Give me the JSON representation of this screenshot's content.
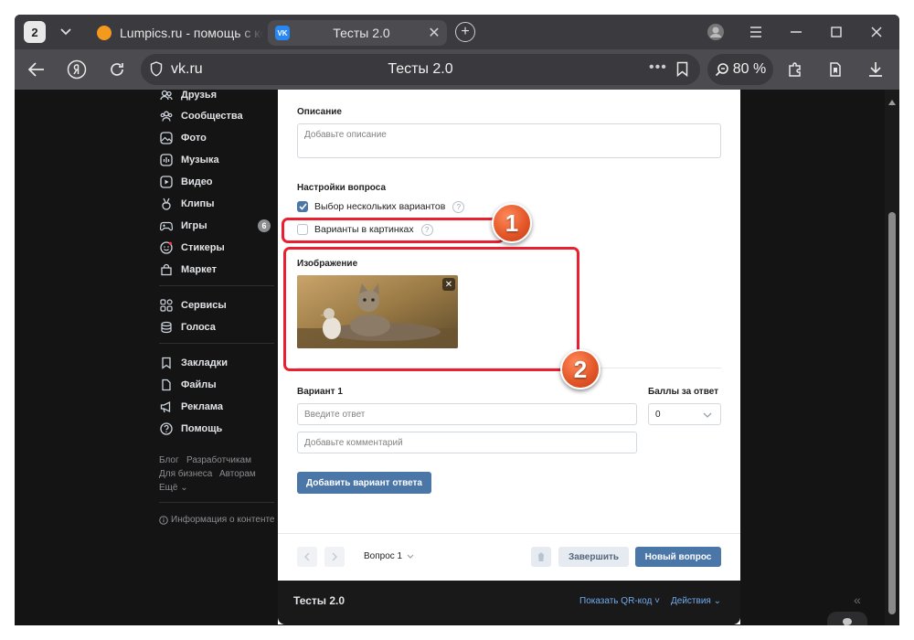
{
  "browser": {
    "tab_count": "2",
    "tabs": [
      {
        "title": "Lumpics.ru - помощь с компьютером",
        "active": false
      },
      {
        "title": "Тесты 2.0",
        "active": true
      }
    ],
    "address": {
      "domain": "vk.ru",
      "page_title": "Тесты 2.0"
    },
    "zoom": "80 %"
  },
  "sidebar": {
    "items": [
      {
        "label": "Друзья",
        "icon": "friends-icon"
      },
      {
        "label": "Сообщества",
        "icon": "communities-icon"
      },
      {
        "label": "Фото",
        "icon": "photo-icon"
      },
      {
        "label": "Музыка",
        "icon": "music-icon"
      },
      {
        "label": "Видео",
        "icon": "video-icon"
      },
      {
        "label": "Клипы",
        "icon": "clips-icon"
      },
      {
        "label": "Игры",
        "icon": "games-icon",
        "badge": "6"
      },
      {
        "label": "Стикеры",
        "icon": "stickers-icon"
      },
      {
        "label": "Маркет",
        "icon": "market-icon"
      },
      {
        "label": "Сервисы",
        "icon": "services-icon"
      },
      {
        "label": "Голоса",
        "icon": "votes-icon"
      },
      {
        "label": "Закладки",
        "icon": "bookmarks-icon"
      },
      {
        "label": "Файлы",
        "icon": "files-icon"
      },
      {
        "label": "Реклама",
        "icon": "ads-icon"
      },
      {
        "label": "Помощь",
        "icon": "help-icon"
      }
    ],
    "footer_links": [
      "Блог",
      "Разработчикам",
      "Для бизнеса",
      "Авторам",
      "Ещё"
    ],
    "content_info": "Информация о контенте"
  },
  "editor": {
    "description_label": "Описание",
    "description_placeholder": "Добавьте описание",
    "settings_label": "Настройки вопроса",
    "option_multiple": {
      "label": "Выбор нескольких вариантов",
      "checked": true
    },
    "option_images": {
      "label": "Варианты в картинках",
      "checked": false
    },
    "image_label": "Изображение",
    "variant_label": "Вариант 1",
    "points_label": "Баллы за ответ",
    "answer_placeholder": "Введите ответ",
    "comment_placeholder": "Добавьте комментарий",
    "points_value": "0",
    "add_variant_button": "Добавить вариант ответа",
    "question_selector": "Вопрос 1",
    "finish_button": "Завершить",
    "new_question_button": "Новый вопрос"
  },
  "footer": {
    "title": "Тесты 2.0",
    "qr_link": "Показать QR-код",
    "actions_link": "Действия"
  },
  "annotations": {
    "badge1": "1",
    "badge2": "2"
  },
  "colors": {
    "accent": "#4a76a8",
    "annotation_red": "#e8202f",
    "badge_orange": "#e4582a"
  }
}
